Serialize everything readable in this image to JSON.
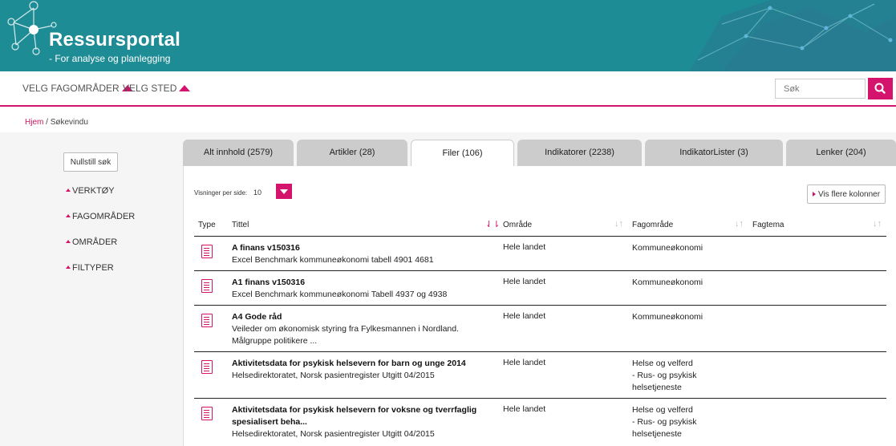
{
  "header": {
    "title": "Ressursportal",
    "subtitle": "- For analyse og planlegging"
  },
  "nav": {
    "items": [
      {
        "label": "VELG FAGOMRÅDER"
      },
      {
        "label": "VELG STED"
      }
    ],
    "search_placeholder": "Søk",
    "search_icon": "search-icon"
  },
  "breadcrumb": {
    "home": "Hjem",
    "separator": " / ",
    "current": "Søkevindu"
  },
  "sidebar": {
    "reset_label": "Nullstill søk",
    "filters": [
      {
        "label": "VERKTØY"
      },
      {
        "label": "FAGOMRÅDER"
      },
      {
        "label": "OMRÅDER"
      },
      {
        "label": "FILTYPER"
      }
    ]
  },
  "tabs": [
    {
      "label": "Alt innhold (2579)",
      "active": false
    },
    {
      "label": "Artikler (28)",
      "active": false
    },
    {
      "label": "Filer (106)",
      "active": true
    },
    {
      "label": "Indikatorer (2238)",
      "active": false
    },
    {
      "label": "IndikatorLister (3)",
      "active": false
    },
    {
      "label": "Lenker (204)",
      "active": false
    }
  ],
  "toolbar": {
    "per_page_label": "Visninger per side:",
    "per_page_value": "10",
    "more_columns_label": "Vis flere kolonner"
  },
  "table": {
    "headers": {
      "type": "Type",
      "title": "Tittel",
      "area": "Område",
      "subject": "Fagområde",
      "theme": "Fagtema"
    },
    "rows": [
      {
        "type_icon": "document-icon",
        "title": "A finans v150316",
        "desc": [
          "Excel Benchmark kommuneøkonomi tabell 4901 4681"
        ],
        "area": "Hele landet",
        "subject": [
          "Kommuneøkonomi"
        ]
      },
      {
        "type_icon": "document-icon",
        "title": "A1 finans v150316",
        "desc": [
          "Excel Benchmark kommuneøkonomi Tabell 4937 og 4938"
        ],
        "area": "Hele landet",
        "subject": [
          "Kommuneøkonomi"
        ]
      },
      {
        "type_icon": "document-icon",
        "title": "A4 Gode råd",
        "desc": [
          "Veileder om økonomisk styring fra Fylkesmannen i Nordland.",
          "Målgruppe politikere ..."
        ],
        "area": "Hele landet",
        "subject": [
          "Kommuneøkonomi"
        ]
      },
      {
        "type_icon": "document-icon",
        "title": "Aktivitetsdata for psykisk helsevern for barn og unge 2014",
        "desc": [
          "Helsedirektoratet, Norsk pasientregister Utgitt 04/2015"
        ],
        "area": "Hele landet",
        "subject": [
          "Helse og velferd",
          "- Rus- og psykisk",
          "helsetjeneste"
        ]
      },
      {
        "type_icon": "document-icon",
        "title": "Aktivitetsdata for psykisk helsevern for voksne og tverrfaglig spesialisert beha...",
        "desc": [
          "Helsedirektoratet, Norsk pasientregister Utgitt 04/2015"
        ],
        "area": "Hele landet",
        "subject": [
          "Helse og velferd",
          "- Rus- og psykisk",
          "helsetjeneste"
        ]
      }
    ]
  },
  "colors": {
    "banner": "#1e8c95",
    "accent": "#d4146c"
  }
}
